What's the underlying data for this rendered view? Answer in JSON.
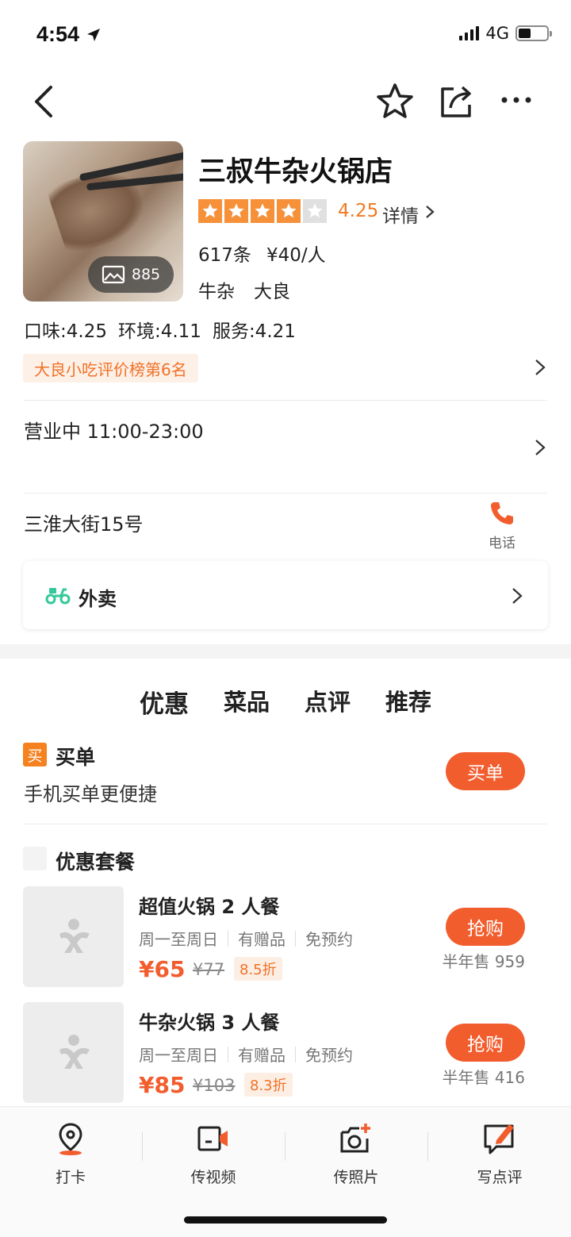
{
  "status_bar": {
    "time": "4:54",
    "network": "4G"
  },
  "nav": {
    "back": "back-icon",
    "favorite": "star-icon",
    "share": "share-icon",
    "more": "more-icon"
  },
  "shop": {
    "name": "三叔牛杂火锅店",
    "photo_count": "885",
    "rating": "4.25",
    "stars_filled": 4,
    "stars_total": 5,
    "rating_detail": "详情",
    "review_count": "617条",
    "per_person": "¥40/人",
    "category": "牛杂",
    "area": "大良",
    "scores": {
      "taste": "口味:4.25",
      "environment": "环境:4.11",
      "service": "服务:4.21"
    },
    "rank_badge": "大良小吃评价榜第6名",
    "hours": "营业中  11:00-23:00",
    "address": "三淮大街15号",
    "phone_label": "电话"
  },
  "delivery": {
    "label": "外卖"
  },
  "tabs": [
    {
      "label": "优惠",
      "active": true
    },
    {
      "label": "菜品",
      "active": false
    },
    {
      "label": "点评",
      "active": false
    },
    {
      "label": "推荐",
      "active": false
    }
  ],
  "buy": {
    "badge": "买",
    "title": "买单",
    "subtitle": "手机买单更便捷",
    "button": "买单"
  },
  "packages": {
    "title": "优惠套餐",
    "items": [
      {
        "name": "超值火锅 2 人餐",
        "tags": [
          "周一至周日",
          "有赠品",
          "免预约"
        ],
        "price": "¥65",
        "original": "¥77",
        "discount": "8.5折",
        "button": "抢购",
        "sold": "半年售 959"
      },
      {
        "name": "牛杂火锅 3 人餐",
        "tags": [
          "周一至周日",
          "有赠品",
          "免预约"
        ],
        "price": "¥85",
        "original": "¥103",
        "discount": "8.3折",
        "button": "抢购",
        "sold": "半年售 416"
      }
    ]
  },
  "bottom_bar": [
    {
      "label": "打卡",
      "icon": "checkin-pin-icon"
    },
    {
      "label": "传视频",
      "icon": "upload-video-icon"
    },
    {
      "label": "传照片",
      "icon": "upload-photo-icon"
    },
    {
      "label": "写点评",
      "icon": "write-review-icon"
    }
  ],
  "colors": {
    "accent": "#f25d2e",
    "star": "#f6913a",
    "badge_bg": "#fdf0e6",
    "delivery_green": "#35c89a"
  }
}
